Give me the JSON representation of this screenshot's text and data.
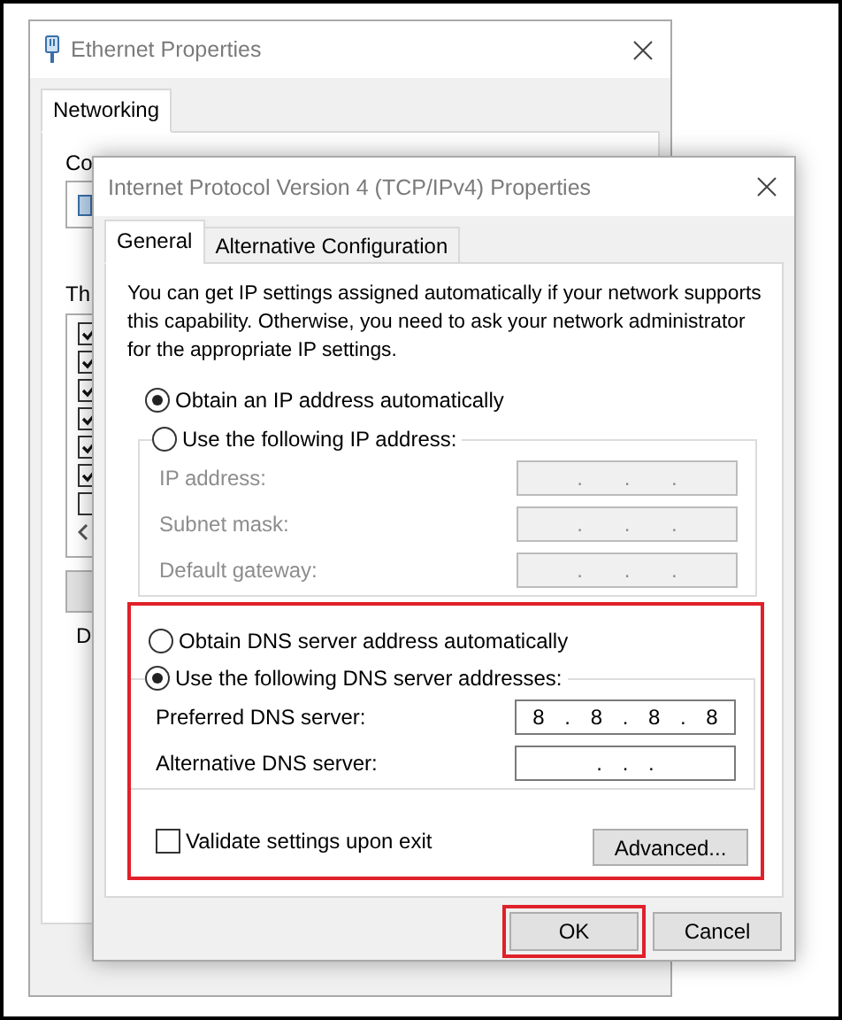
{
  "back_window": {
    "title": "Ethernet Properties",
    "tabs": [
      {
        "label": "Networking",
        "selected": true
      }
    ],
    "connect_label": "Co",
    "items_label": "Th",
    "items": [
      {
        "checked": true
      },
      {
        "checked": true
      },
      {
        "checked": true
      },
      {
        "checked": true
      },
      {
        "checked": true
      },
      {
        "checked": true
      },
      {
        "checked": false
      }
    ],
    "group_label": "D"
  },
  "dialog": {
    "title": "Internet Protocol Version 4 (TCP/IPv4) Properties",
    "tabs": [
      {
        "label": "General",
        "selected": true
      },
      {
        "label": "Alternative Configuration",
        "selected": false
      }
    ],
    "description": "You can get IP settings assigned automatically if your network supports this capability. Otherwise, you need to ask your network administrator for the appropriate IP settings.",
    "ip_section": {
      "highlighted": false,
      "options": [
        {
          "label": "Obtain an IP address automatically",
          "selected": true
        },
        {
          "label": "Use the following IP address:",
          "selected": false
        }
      ],
      "fields": [
        {
          "label": "IP address:",
          "value": ". . .",
          "disabled": true
        },
        {
          "label": "Subnet mask:",
          "value": ". . .",
          "disabled": true
        },
        {
          "label": "Default gateway:",
          "value": ". . .",
          "disabled": true
        }
      ]
    },
    "dns_section": {
      "highlighted": true,
      "options": [
        {
          "label": "Obtain DNS server address automatically",
          "selected": false
        },
        {
          "label": "Use the following DNS server addresses:",
          "selected": true
        }
      ],
      "fields": [
        {
          "label": "Preferred DNS server:",
          "value": "8 . 8 . 8 . 8",
          "disabled": false
        },
        {
          "label": "Alternative DNS server:",
          "value": ". . .",
          "disabled": false
        }
      ],
      "validate": {
        "label": "Validate settings upon exit",
        "checked": false
      },
      "advanced_button": "Advanced..."
    },
    "buttons": [
      {
        "label": "OK",
        "highlighted": true
      },
      {
        "label": "Cancel",
        "highlighted": false
      }
    ]
  }
}
